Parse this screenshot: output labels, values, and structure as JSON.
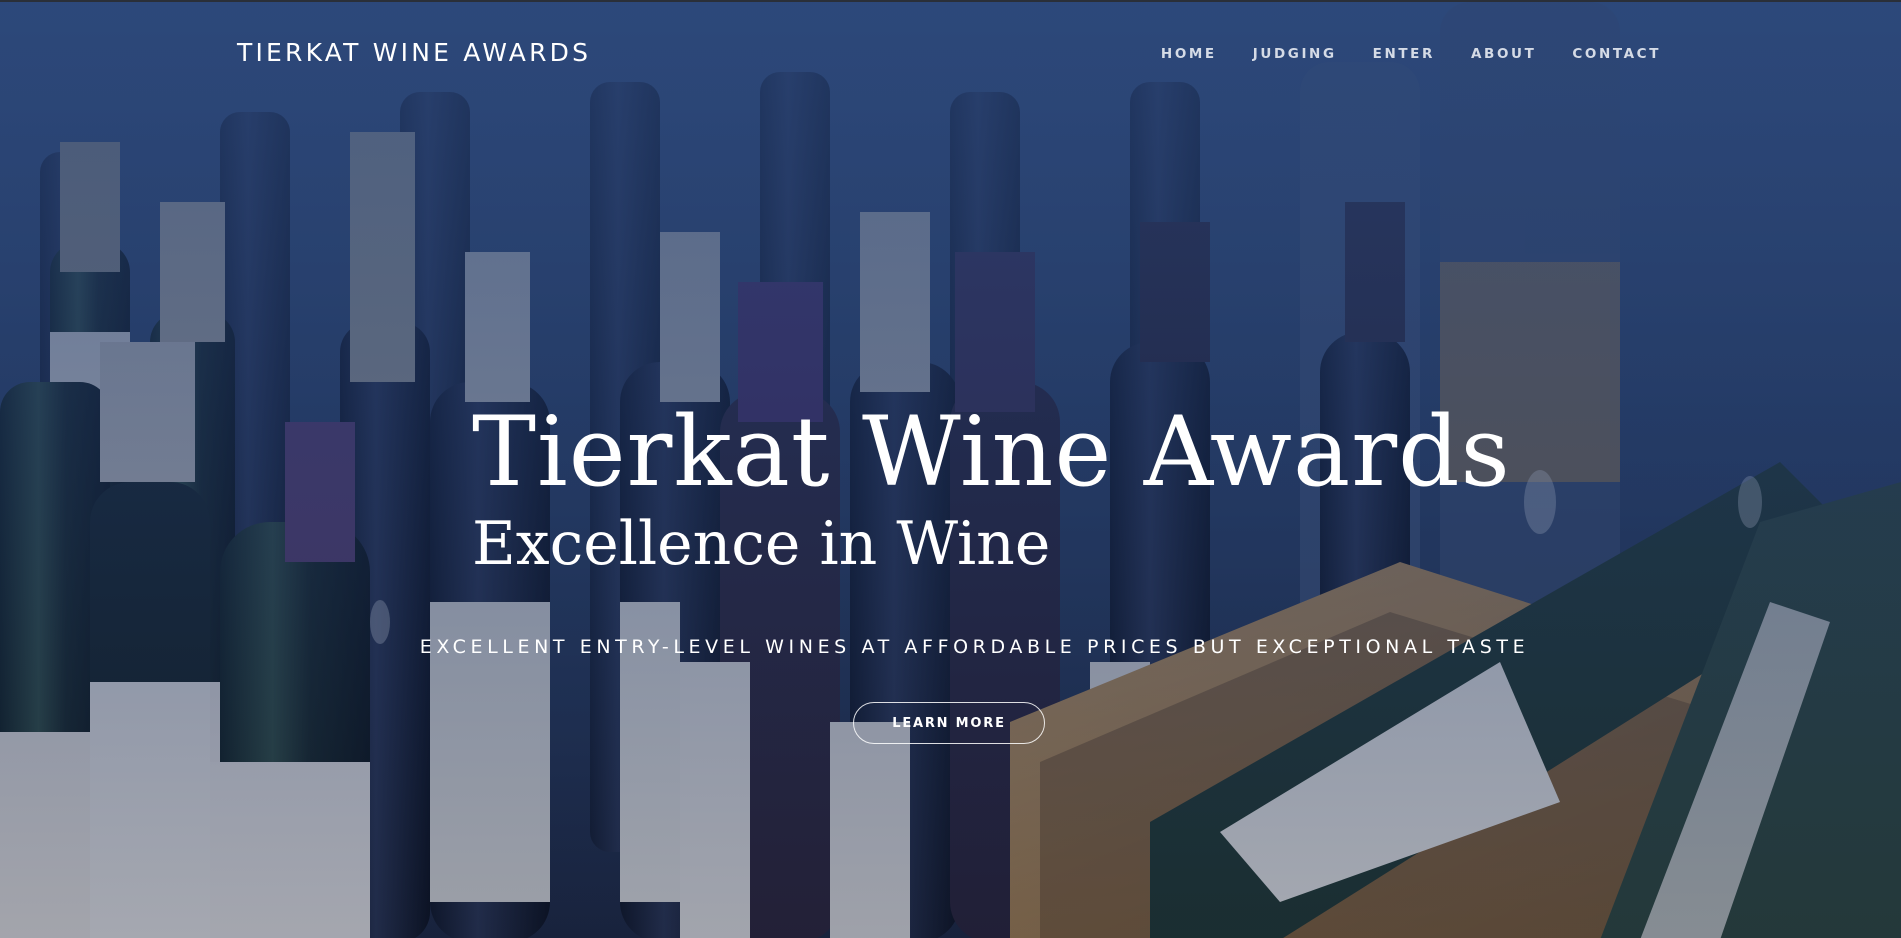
{
  "navbar": {
    "brand": "TIERKAT WINE AWARDS",
    "links": [
      {
        "label": "HOME"
      },
      {
        "label": "JUDGING"
      },
      {
        "label": "ENTER"
      },
      {
        "label": "ABOUT"
      },
      {
        "label": "CONTACT"
      }
    ]
  },
  "hero": {
    "title": "Tierkat Wine Awards",
    "subtitle": "Excellence in Wine",
    "tagline": "EXCELLENT ENTRY-LEVEL WINES AT AFFORDABLE PRICES BUT EXCEPTIONAL TASTE",
    "cta_label": "LEARN MORE",
    "background_image": "wine-bottles-photo"
  },
  "colors": {
    "overlay": "#274378",
    "text": "#ffffff",
    "nav_text": "#d5dbe6"
  }
}
